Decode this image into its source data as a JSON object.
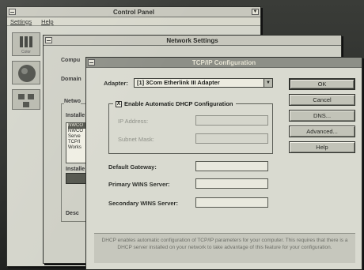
{
  "control_panel": {
    "title": "Control Panel",
    "menu": [
      "Settings",
      "Help"
    ],
    "icons": [
      {
        "name": "color-icon",
        "label": "Color"
      },
      {
        "name": "globe-icon",
        "label": ""
      },
      {
        "name": "network-icon",
        "label": ""
      }
    ]
  },
  "network_settings": {
    "title": "Network Settings",
    "computer_label": "Compu",
    "domain_label": "Domain",
    "network_label": "Netwo",
    "installed_label": "Installe",
    "list_items": [
      "NWCO",
      "NWCO",
      "Serve",
      "TCP/I",
      "Works"
    ],
    "installed2_label": "Installe",
    "desc_label": "Desc"
  },
  "tcp_dialog": {
    "title": "TCP/IP Configuration",
    "adapter_label": "Adapter:",
    "adapter_value": "[1] 3Com Etherlink III Adapter",
    "dhcp_checkbox": "Enable Automatic DHCP Configuration",
    "dhcp_checked": "X",
    "ip_label": "IP Address:",
    "subnet_label": "Subnet Mask:",
    "gateway_label": "Default Gateway:",
    "primary_wins_label": "Primary WINS Server:",
    "secondary_wins_label": "Secondary WINS Server:",
    "buttons": {
      "ok": "OK",
      "cancel": "Cancel",
      "dns": "DNS...",
      "advanced": "Advanced...",
      "help": "Help"
    },
    "status_text": "DHCP enables automatic configuration of TCP/IP parameters for your computer. This requires that there is a DHCP server installed on your network to take advantage of this feature for your configuration."
  }
}
